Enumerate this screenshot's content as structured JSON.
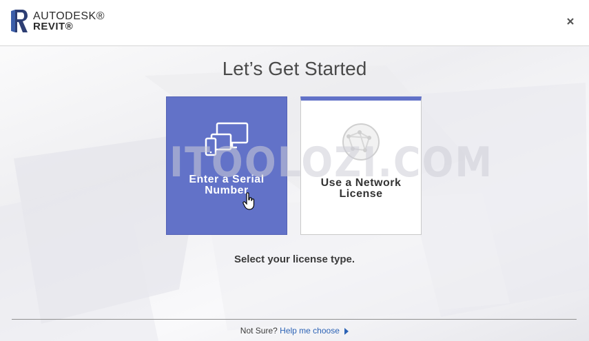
{
  "header": {
    "brand": "AUTODESK®",
    "product": "REVIT®",
    "close_icon": "close-icon"
  },
  "main": {
    "title": "Let’s Get Started",
    "cards": [
      {
        "label_line1": "Enter a Serial",
        "label_line2": "Number",
        "icon": "devices-icon",
        "selected": true
      },
      {
        "label_line1": "Use a Network",
        "label_line2": "License",
        "icon": "network-globe-icon",
        "selected": false
      }
    ],
    "watermark": "ITOOLOZI.COM",
    "subtitle": "Select your license type."
  },
  "footer": {
    "prompt": "Not Sure?",
    "help_link": "Help me choose",
    "caret_icon": "caret-right-icon"
  },
  "colors": {
    "accent": "#6272c8",
    "link": "#2b62b5",
    "header_bg": "#ffffff"
  }
}
